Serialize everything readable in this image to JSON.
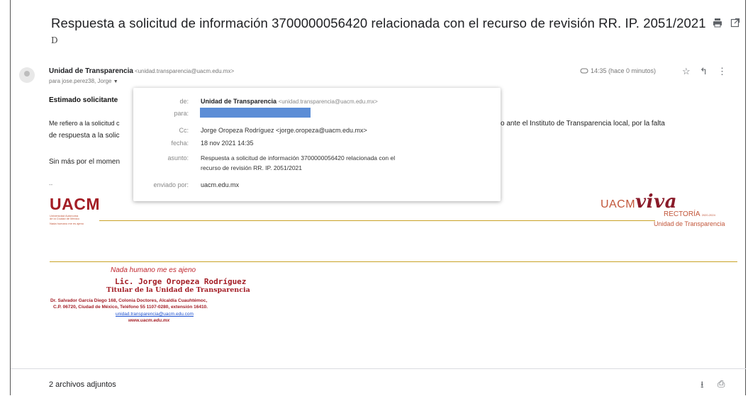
{
  "email": {
    "subject": "Respuesta a solicitud de información 3700000056420 relacionada con el recurso de revisión RR. IP. 2051/2021",
    "subject_extra": "D",
    "actions": {
      "print_icon": "print-icon",
      "open_new_icon": "open-in-new-window-icon"
    },
    "sender_name": "Unidad de Transparencia",
    "sender_email": "<unidad.transparencia@uacm.edu.mx>",
    "to_line": "para jose.perez38, Jorge",
    "time": "14:35 (hace 0 minutos)",
    "greeting": "Estimado solicitante",
    "body_line1_start": "Me refiero a la solicitud c",
    "body_line1_end": "o ante el Instituto de Transparencia local, por la falta",
    "body_line2": "de respuesta a la solic",
    "body_line3": "Sin más por el momen",
    "dash": "--",
    "attachments_label": "2 archivos adjuntos"
  },
  "popup": {
    "de_label": "de:",
    "de_name": "Unidad de Transparencia",
    "de_email": "<unidad.transparencia@uacm.edu.mx>",
    "para_label": "para:",
    "cc_label": "Cc:",
    "cc_value": "Jorge Oropeza Rodríguez <jorge.oropeza@uacm.edu.mx>",
    "fecha_label": "fecha:",
    "fecha_value": "18 nov 2021 14:35",
    "asunto_label": "asunto:",
    "asunto_line1": "Respuesta a solicitud de información 3700000056420 relacionada con el",
    "asunto_line2": "recurso de revisión RR. IP. 2051/2021",
    "enviado_label": "enviado por:",
    "enviado_value": "uacm.edu.mx"
  },
  "logos": {
    "uacm": "UACM",
    "uacm_sub1": "Universidad Autónoma",
    "uacm_sub2": "de la Ciudad de México",
    "uacm_sub3": "Nada humano me es ajeno",
    "uacm_left": "UACM",
    "viva": "viva",
    "rectoria": "RECTORÍA",
    "rectoria_years": "2020-2024",
    "unidad": "Unidad de Transparencia"
  },
  "signature": {
    "motto": "Nada humano me es ajeno",
    "name": "Lic. Jorge Oropeza Rodríguez",
    "title": "Titular de la Unidad de Transparencia",
    "address1": "Dr. Salvador García Diego 168, Colonia Doctores, Alcaldía Cuauhtémoc,",
    "address2": "C.P. 06720, Ciudad de México, Teléfono 55 1107-0280, extensión 16410.",
    "email": "unidad.transparencia@uacm.edu.com",
    "web": "www.uacm.edu.mx"
  },
  "colors": {
    "accent_red": "#a31d25",
    "gold": "#c9a227",
    "link_blue": "#1a4fcf",
    "redaction": "#5b8dd6"
  }
}
